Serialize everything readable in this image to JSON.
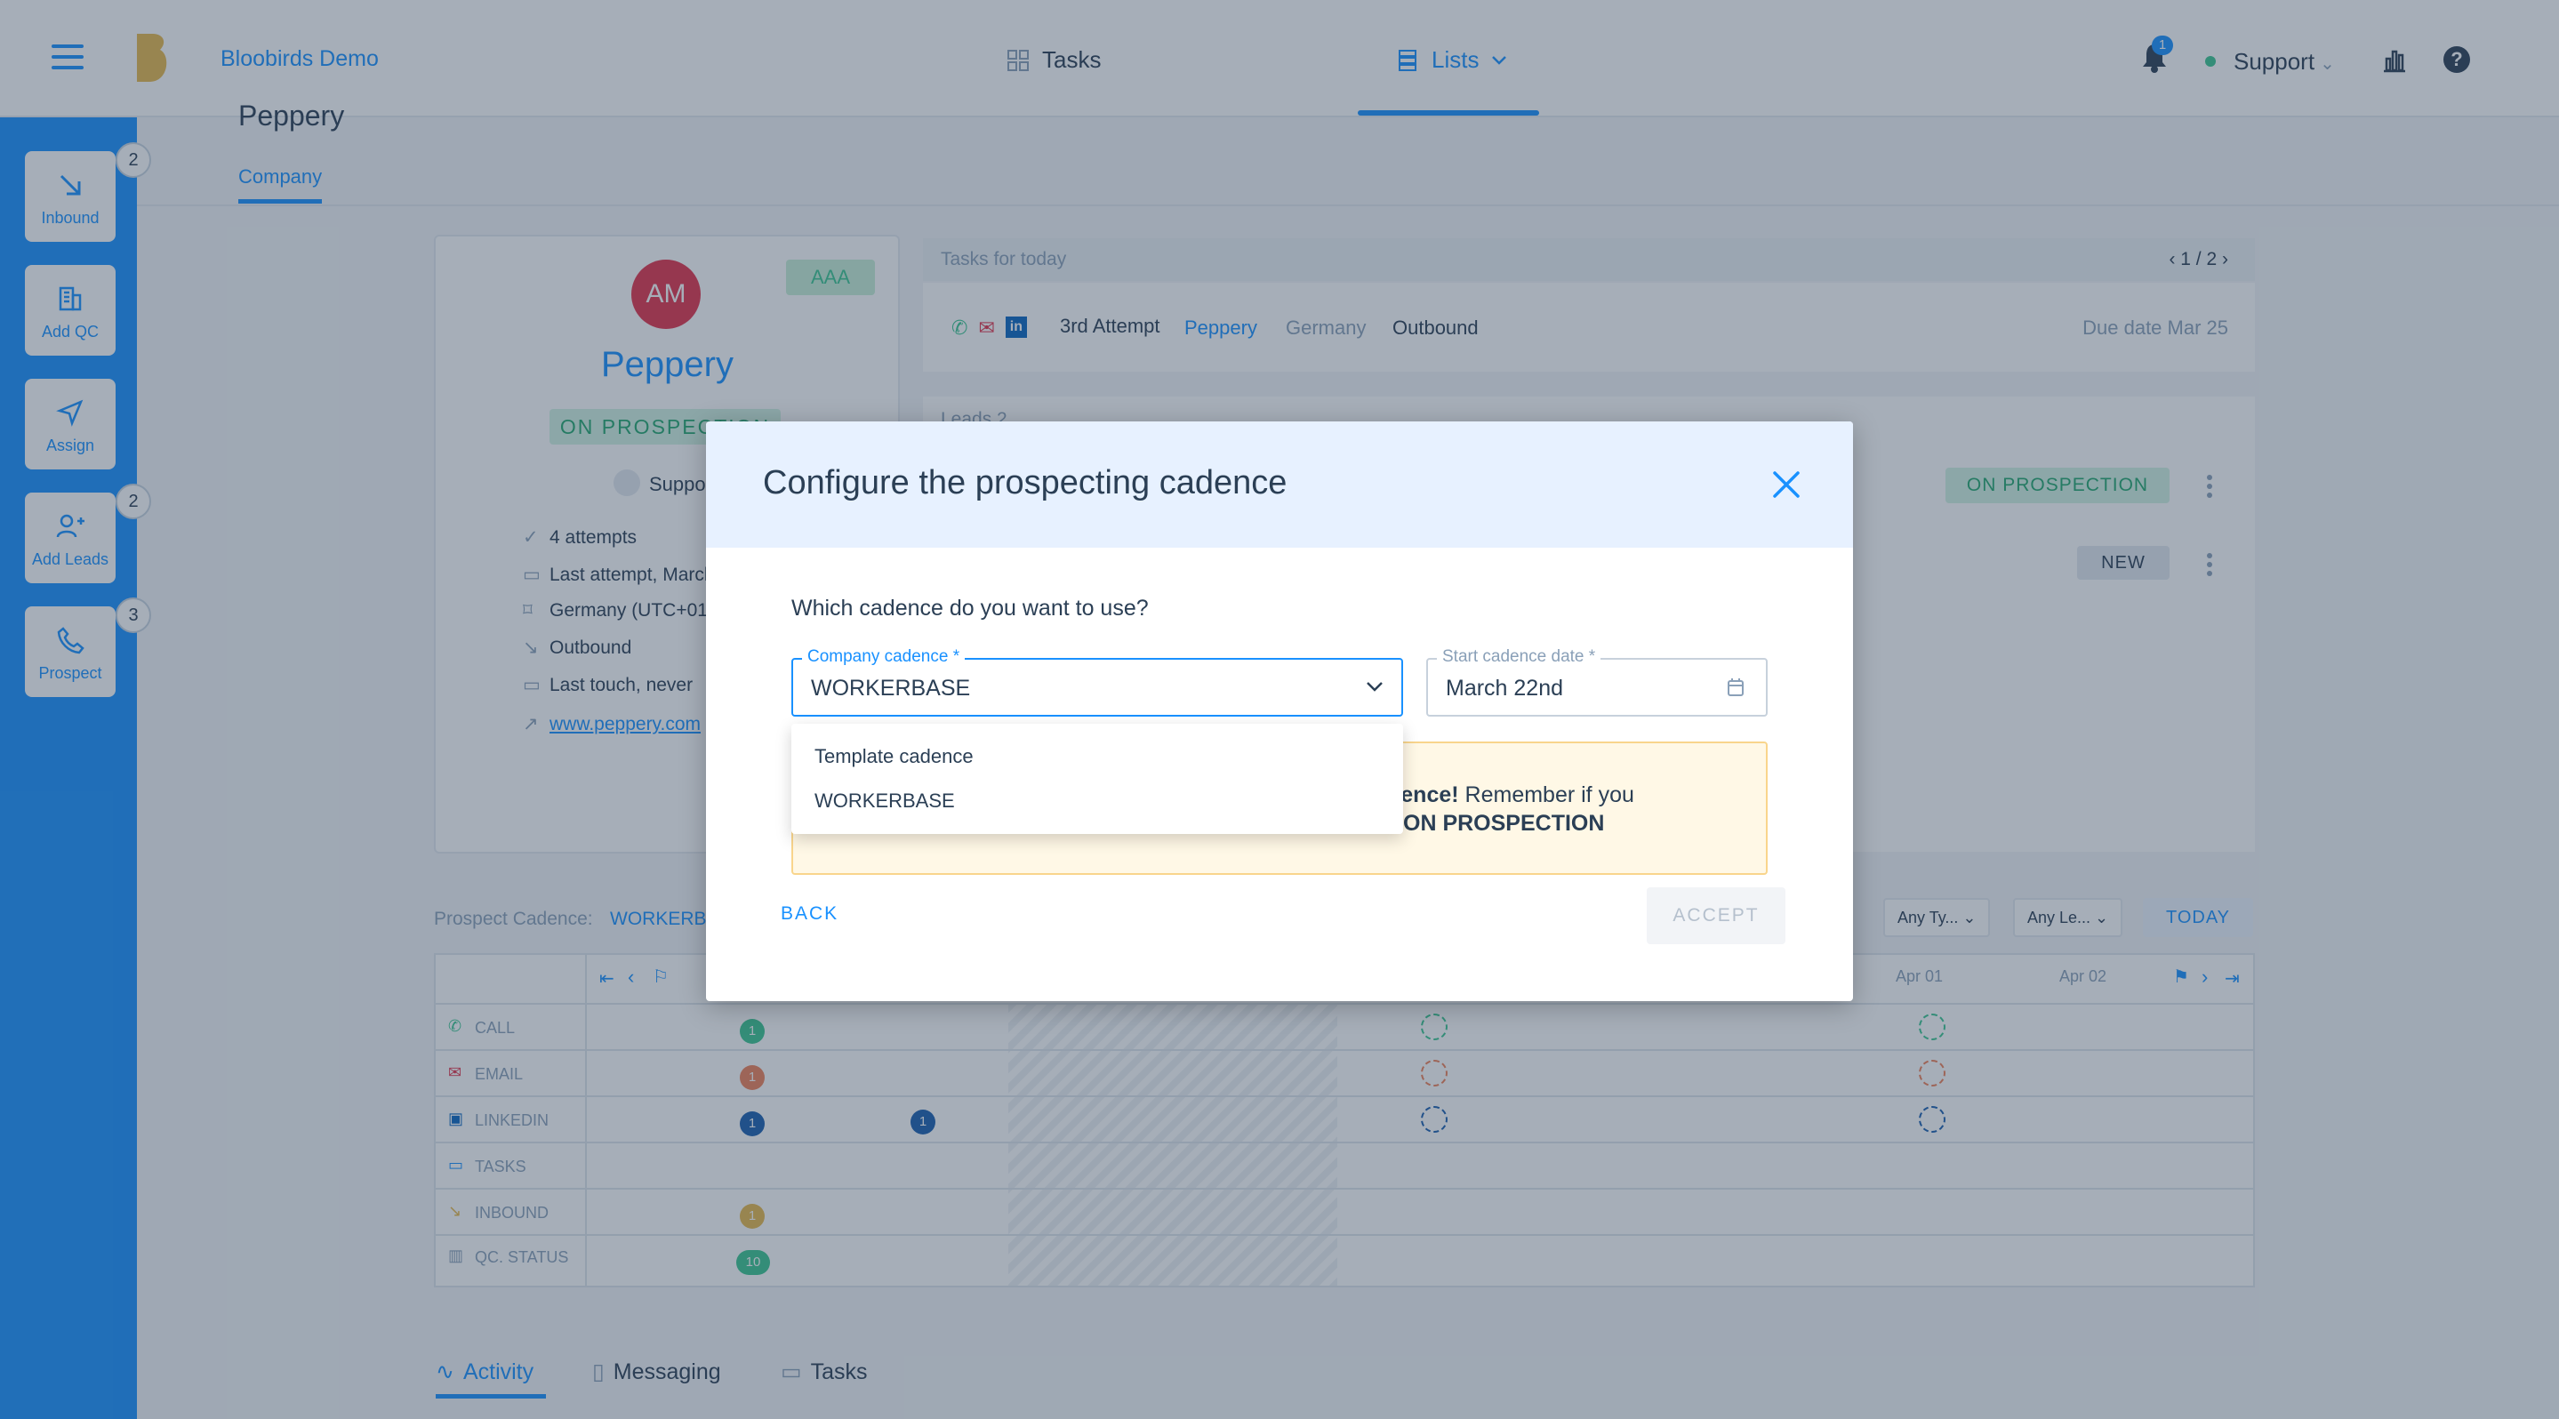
{
  "app": {
    "brand": "Bloobirds Demo"
  },
  "nav": {
    "tasks": "Tasks",
    "lists": "Lists"
  },
  "header": {
    "notification_count": "1",
    "user": "Support"
  },
  "sidebar": {
    "items": [
      {
        "label": "Inbound",
        "badge": "2"
      },
      {
        "label": "Add QC",
        "badge": ""
      },
      {
        "label": "Assign",
        "badge": ""
      },
      {
        "label": "Add Leads",
        "badge": "2"
      },
      {
        "label": "Prospect",
        "badge": "3"
      }
    ]
  },
  "page": {
    "breadcrumb": "Peppery",
    "tab": "Company"
  },
  "company": {
    "initials": "AM",
    "rating": "AAA",
    "name": "Peppery",
    "status": "ON PROSPECTION",
    "owner": "Support",
    "info": [
      "4 attempts",
      "Last attempt, March",
      "Germany (UTC+01",
      "Outbound",
      "Last touch, never",
      "www.peppery.com"
    ]
  },
  "tasks_today": {
    "title": "Tasks for today",
    "pager": "1 / 2",
    "attempt": "3rd Attempt",
    "company": "Peppery",
    "country": "Germany",
    "source": "Outbound",
    "due": "Due date Mar 25"
  },
  "leads": {
    "header": "Leads 2",
    "status1": "ON PROSPECTION",
    "status2": "NEW"
  },
  "cadence_panel": {
    "label": "Prospect Cadence:",
    "value": "WORKERBASE",
    "filters": [
      "Any Ty...",
      "Any Le..."
    ],
    "today": "TODAY",
    "dates": [
      "Apr 01",
      "Apr 02"
    ],
    "rows": [
      "CALL",
      "EMAIL",
      "LINKEDIN",
      "TASKS",
      "INBOUND",
      "QC. STATUS"
    ],
    "counts": {
      "call": "1",
      "email": "1",
      "linkedin": "1",
      "linkedin2": "1",
      "inbound": "1",
      "qc": "10"
    }
  },
  "bottom_tabs": [
    "Activity",
    "Messaging",
    "Tasks"
  ],
  "modal": {
    "title": "Configure the prospecting cadence",
    "question": "Which cadence do you want to use?",
    "cadence_label": "Company cadence *",
    "cadence_value": "WORKERBASE",
    "date_label": "Start cadence date *",
    "date_value": "March 22nd",
    "warning_bold": "dence!",
    "warning_text": " Remember if you",
    "warning_line2": "ON PROSPECTION",
    "options": [
      "Template cadence",
      "WORKERBASE"
    ],
    "back": "BACK",
    "accept": "ACCEPT"
  },
  "colors": {
    "accent": "#1991ff",
    "success": "#3cc792",
    "warning_bg": "#fff8e6"
  }
}
